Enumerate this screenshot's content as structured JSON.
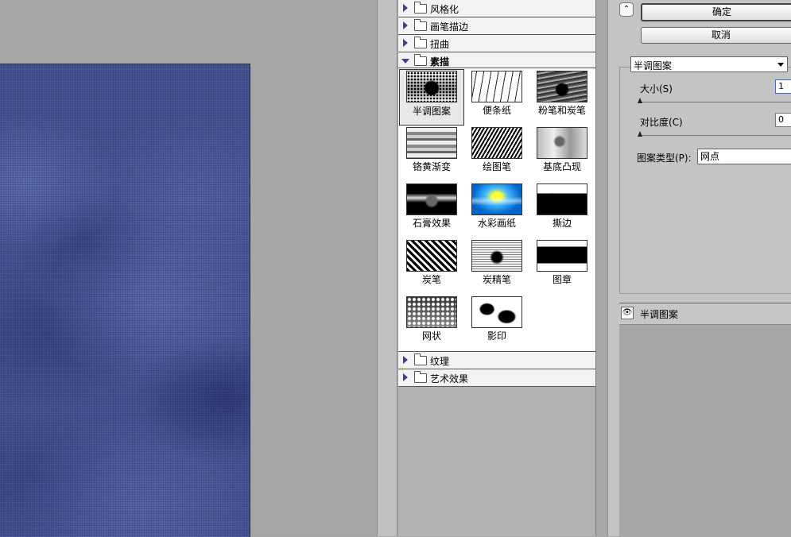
{
  "gallery": {
    "categories": {
      "stylize": "风格化",
      "brush_strokes": "画笔描边",
      "distort": "扭曲",
      "sketch": "素描",
      "texture": "纹理",
      "artistic": "艺术效果"
    },
    "filters": [
      {
        "label": "半调图案",
        "icon": "halftone-pattern-thumbnail",
        "selected": true
      },
      {
        "label": "便条纸",
        "icon": "note-paper-thumbnail"
      },
      {
        "label": "粉笔和炭笔",
        "icon": "chalk-charcoal-thumbnail"
      },
      {
        "label": "铬黄渐变",
        "icon": "chrome-thumbnail"
      },
      {
        "label": "绘图笔",
        "icon": "graphic-pen-thumbnail"
      },
      {
        "label": "基底凸现",
        "icon": "bas-relief-thumbnail"
      },
      {
        "label": "石膏效果",
        "icon": "plaster-thumbnail"
      },
      {
        "label": "水彩画纸",
        "icon": "water-paper-thumbnail"
      },
      {
        "label": "撕边",
        "icon": "torn-edges-thumbnail"
      },
      {
        "label": "炭笔",
        "icon": "charcoal-thumbnail"
      },
      {
        "label": "炭精笔",
        "icon": "conte-crayon-thumbnail"
      },
      {
        "label": "图章",
        "icon": "stamp-thumbnail"
      },
      {
        "label": "网状",
        "icon": "reticulation-thumbnail"
      },
      {
        "label": "影印",
        "icon": "photocopy-thumbnail"
      }
    ]
  },
  "settings": {
    "ok_label": "确定",
    "cancel_label": "取消",
    "filter_selected": "半调图案",
    "size_label": "大小(S)",
    "size_value": "1",
    "contrast_label": "对比度(C)",
    "contrast_value": "0",
    "pattern_type_label": "图案类型(P):",
    "pattern_type_value": "网点"
  },
  "effects": {
    "active_effect": "半调图案"
  }
}
